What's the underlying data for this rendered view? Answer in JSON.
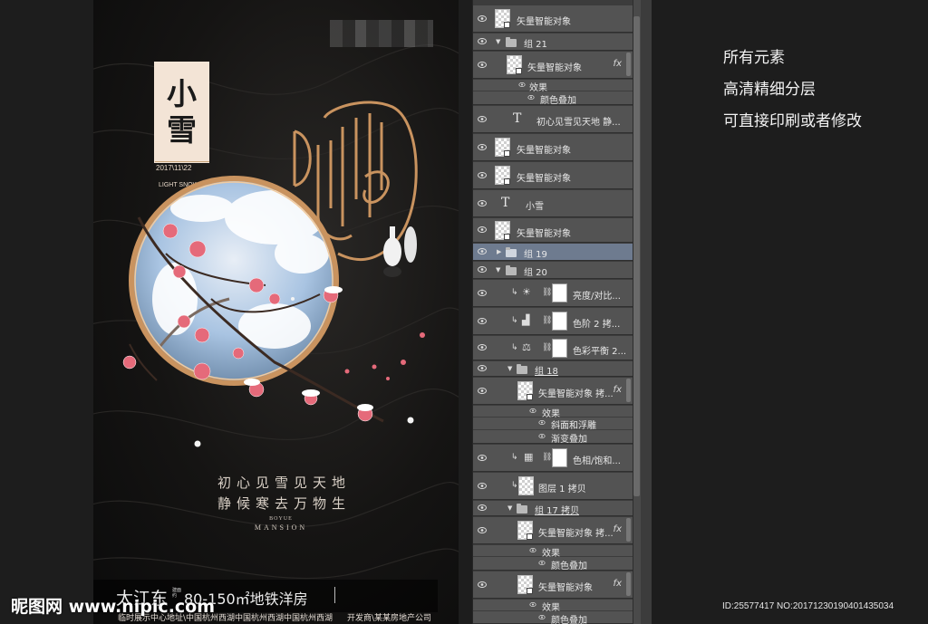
{
  "poster": {
    "title_chars": [
      "小",
      "雪"
    ],
    "date": "2017\\11\\22",
    "english_name": "LIGHT SNOW",
    "slogan_1": "初心见雪见天地",
    "slogan_2": "静候寒去万物生",
    "brand_small": "BOYUE",
    "brand_big": "MANSION",
    "area_name": "太江东",
    "area_small": "建面约",
    "area_size": "80-150㎡地铁洋房",
    "address": "临时展示中心地址\\中国杭州西湖中国杭州西湖中国杭州西湖",
    "developer": "开发商\\某某房地产公司"
  },
  "layers": [
    {
      "label": "矢量智能对象",
      "kind": "smart"
    },
    {
      "label": "组 21",
      "kind": "group-open"
    },
    {
      "label": "矢量智能对象",
      "kind": "smart-fx",
      "fx": "fx"
    },
    {
      "label": "效果",
      "kind": "effect"
    },
    {
      "label": "颜色叠加",
      "kind": "effect-item"
    },
    {
      "label": "初心见雪见天地 静...",
      "kind": "text"
    },
    {
      "label": "矢量智能对象",
      "kind": "smart"
    },
    {
      "label": "矢量智能对象",
      "kind": "smart"
    },
    {
      "label": "小雪",
      "kind": "text"
    },
    {
      "label": "矢量智能对象",
      "kind": "smart"
    },
    {
      "label": "组 19",
      "kind": "group-closed"
    },
    {
      "label": "组 20",
      "kind": "group-open"
    },
    {
      "label": "亮度/对比...",
      "kind": "adjust",
      "icon": "☀"
    },
    {
      "label": "色阶 2 拷...",
      "kind": "adjust",
      "icon": "▟"
    },
    {
      "label": "色彩平衡 2...",
      "kind": "adjust",
      "icon": "⚖"
    },
    {
      "label": "组 18",
      "kind": "group-open"
    },
    {
      "label": "矢量智能对象 拷...",
      "kind": "smart-fx",
      "fx": "fx"
    },
    {
      "label": "效果",
      "kind": "effect"
    },
    {
      "label": "斜面和浮雕",
      "kind": "effect-item"
    },
    {
      "label": "渐变叠加",
      "kind": "effect-item"
    },
    {
      "label": "色相/饱和...",
      "kind": "adjust",
      "icon": "▦"
    },
    {
      "label": "图层 1 拷贝",
      "kind": "image"
    },
    {
      "label": "组 17 拷贝",
      "kind": "group-open"
    },
    {
      "label": "矢量智能对象 拷...",
      "kind": "smart-fx",
      "fx": "fx"
    },
    {
      "label": "效果",
      "kind": "effect"
    },
    {
      "label": "颜色叠加",
      "kind": "effect-item"
    },
    {
      "label": "矢量智能对象",
      "kind": "smart-fx",
      "fx": "fx"
    },
    {
      "label": "效果",
      "kind": "effect"
    },
    {
      "label": "颜色叠加",
      "kind": "effect-item"
    }
  ],
  "selected_layer": "组 19",
  "features": [
    "所有元素",
    "高清精细分层",
    "可直接印刷或者修改"
  ],
  "watermark": "昵图网 www.nipic.com",
  "image_id": "ID:25577417 NO:20171230190401435034",
  "colors": {
    "panel_bg": "#3c3c3c",
    "row_bg": "#535353",
    "selected_row": "#6e7b8f",
    "poster_bg": "#151413",
    "title_card": "#f3e4d6",
    "gold_ring": "#c9935f"
  }
}
